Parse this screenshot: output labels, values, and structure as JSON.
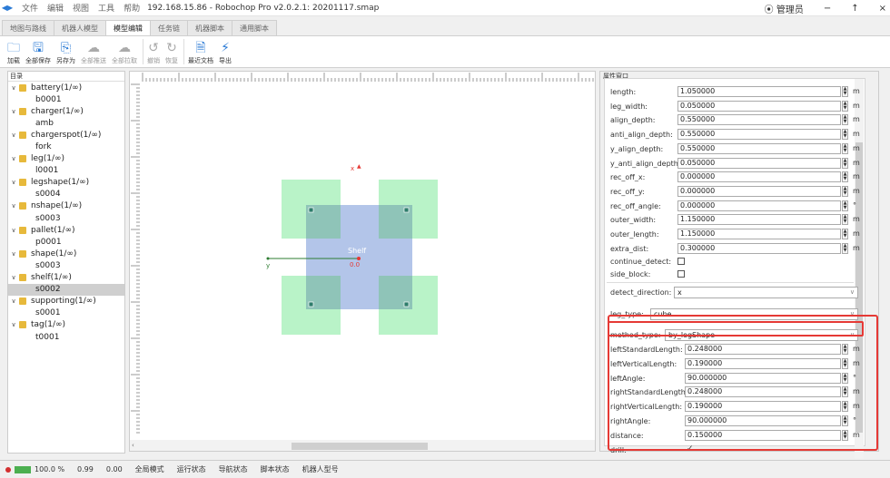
{
  "window": {
    "menu": [
      "文件",
      "编辑",
      "视图",
      "工具",
      "帮助"
    ],
    "title": "192.168.15.86 - Robochop Pro v2.0.2.1: 20201117.smap",
    "user": "管理员",
    "minimize": "−",
    "maximize": "↑",
    "close": "×"
  },
  "tabs": [
    {
      "label": "地图与路线"
    },
    {
      "label": "机器人模型"
    },
    {
      "label": "模型编辑"
    },
    {
      "label": "任务链"
    },
    {
      "label": "机器脚本"
    },
    {
      "label": "通用脚本"
    }
  ],
  "toolbar": [
    {
      "label": "加载",
      "icon": "folder-icon"
    },
    {
      "label": "全部保存",
      "icon": "save-icon"
    },
    {
      "label": "另存为",
      "icon": "save-as-icon"
    },
    {
      "label": "全部推送",
      "icon": "upload-icon"
    },
    {
      "label": "全部拉取",
      "icon": "download-icon"
    },
    {
      "label": "撤销",
      "icon": "undo-icon"
    },
    {
      "label": "恢复",
      "icon": "redo-icon"
    },
    {
      "label": "最近文档",
      "icon": "document-icon"
    },
    {
      "label": "导出",
      "icon": "export-icon"
    }
  ],
  "tree": {
    "header": "目录",
    "groups": [
      {
        "label": "battery(1/∞)",
        "child": "b0001"
      },
      {
        "label": "charger(1/∞)",
        "child": "amb"
      },
      {
        "label": "chargerspot(1/∞)",
        "child": "fork"
      },
      {
        "label": "leg(1/∞)",
        "child": "l0001"
      },
      {
        "label": "legshape(1/∞)",
        "child": "s0004"
      },
      {
        "label": "nshape(1/∞)",
        "child": "s0003"
      },
      {
        "label": "pallet(1/∞)",
        "child": "p0001"
      },
      {
        "label": "shape(1/∞)",
        "child": "s0003"
      },
      {
        "label": "shelf(1/∞)",
        "child": "s0002"
      },
      {
        "label": "supporting(1/∞)",
        "child": "s0001"
      },
      {
        "label": "tag(1/∞)",
        "child": "t0001"
      }
    ],
    "selected_child": "s0002"
  },
  "canvas": {
    "shape_label": "Shelf",
    "center_label": "0.0",
    "x_axis_label": "x",
    "y_axis_label": "y"
  },
  "props": {
    "header": "属性窗口",
    "numeric_rows": [
      {
        "label": "length:",
        "value": "1.050000",
        "unit": "m"
      },
      {
        "label": "leg_width:",
        "value": "0.050000",
        "unit": "m"
      },
      {
        "label": "align_depth:",
        "value": "0.550000",
        "unit": "m"
      },
      {
        "label": "anti_align_depth:",
        "value": "0.550000",
        "unit": "m"
      },
      {
        "label": "y_align_depth:",
        "value": "0.550000",
        "unit": "m"
      },
      {
        "label": "y_anti_align_depth:",
        "value": "0.050000",
        "unit": "m"
      },
      {
        "label": "rec_off_x:",
        "value": "0.000000",
        "unit": "m"
      },
      {
        "label": "rec_off_y:",
        "value": "0.000000",
        "unit": "m"
      },
      {
        "label": "rec_off_angle:",
        "value": "0.000000",
        "unit": "°"
      },
      {
        "label": "outer_width:",
        "value": "1.150000",
        "unit": "m"
      },
      {
        "label": "outer_length:",
        "value": "1.150000",
        "unit": "m"
      },
      {
        "label": "extra_dist:",
        "value": "0.300000",
        "unit": "m"
      }
    ],
    "continue_detect": "continue_detect:",
    "side_block": "side_block:",
    "detect_direction_label": "detect_direction:",
    "detect_direction_value": "x",
    "leg_type_label": "leg_type:",
    "leg_type_value": "cube",
    "method_type_label": "method_type:",
    "method_type_value": "by_legShape",
    "method_rows": [
      {
        "label": "leftStandardLength:",
        "value": "0.248000",
        "unit": "m"
      },
      {
        "label": "leftVerticalLength:",
        "value": "0.190000",
        "unit": "m"
      },
      {
        "label": "leftAngle:",
        "value": "90.000000",
        "unit": "°"
      },
      {
        "label": "rightStandardLength:",
        "value": "0.248000",
        "unit": "m"
      },
      {
        "label": "rightVerticalLength:",
        "value": "0.190000",
        "unit": "m"
      },
      {
        "label": "rightAngle:",
        "value": "90.000000",
        "unit": "°"
      },
      {
        "label": "distance:",
        "value": "0.150000",
        "unit": "m"
      }
    ],
    "drill_label": "drill:",
    "drill_check": "✓"
  },
  "status": {
    "zoom": "100.0 %",
    "items": [
      "0.99",
      "0.00",
      "全局模式",
      "运行状态",
      "导航状态",
      "脚本状态",
      "机器人型号"
    ]
  }
}
